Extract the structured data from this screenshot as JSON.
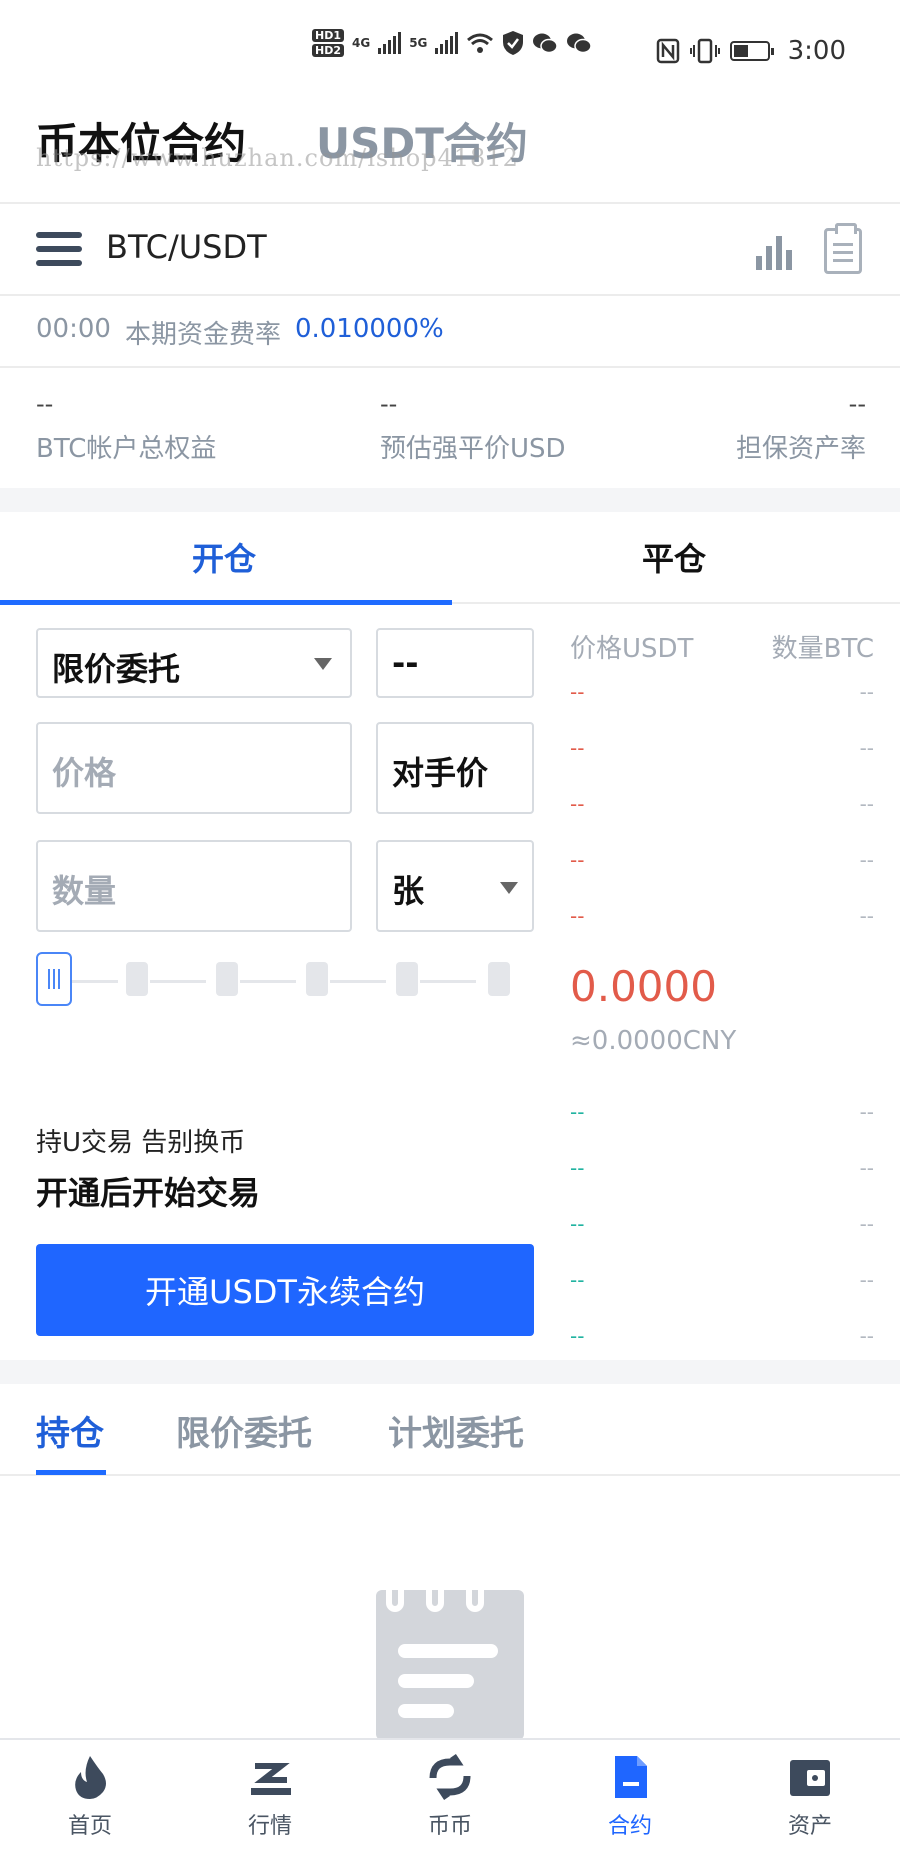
{
  "status_bar": {
    "hd1": "HD1",
    "hd2": "HD2",
    "net1": "4G",
    "net2": "5G",
    "time": "3:00"
  },
  "header": {
    "tab_coin": "币本位合约",
    "tab_usdt": "USDT合约",
    "watermark": "https://www.huzhan.com/ishop41812"
  },
  "symbol": "BTC/USDT",
  "funding": {
    "countdown": "00:00",
    "label": "本期资金费率",
    "rate": "0.010000%"
  },
  "stats": [
    {
      "value": "--",
      "label": "BTC帐户总权益"
    },
    {
      "value": "--",
      "label": "预估强平价USD"
    },
    {
      "value": "--",
      "label": "担保资产率"
    }
  ],
  "trade_tabs": {
    "open": "开仓",
    "close": "平仓"
  },
  "form": {
    "order_type": "限价委托",
    "leverage": "--",
    "price_placeholder": "价格",
    "counter_price": "对手价",
    "qty_placeholder": "数量",
    "unit": "张"
  },
  "promo": {
    "line1": "持U交易 告别换币",
    "line2": "开通后开始交易",
    "button": "开通USDT永续合约"
  },
  "orderbook": {
    "price_header": "价格USDT",
    "qty_header": "数量BTC",
    "asks": [
      {
        "p": "--",
        "q": "--"
      },
      {
        "p": "--",
        "q": "--"
      },
      {
        "p": "--",
        "q": "--"
      },
      {
        "p": "--",
        "q": "--"
      },
      {
        "p": "--",
        "q": "--"
      }
    ],
    "last_price": "0.0000",
    "last_cny": "≈0.0000CNY",
    "bids": [
      {
        "p": "--",
        "q": "--"
      },
      {
        "p": "--",
        "q": "--"
      },
      {
        "p": "--",
        "q": "--"
      },
      {
        "p": "--",
        "q": "--"
      },
      {
        "p": "--",
        "q": "--"
      }
    ]
  },
  "position_tabs": [
    "持仓",
    "限价委托",
    "计划委托"
  ],
  "nav": [
    {
      "label": "首页",
      "icon": "flame-icon"
    },
    {
      "label": "行情",
      "icon": "market-icon"
    },
    {
      "label": "币币",
      "icon": "exchange-icon"
    },
    {
      "label": "合约",
      "icon": "contract-icon"
    },
    {
      "label": "资产",
      "icon": "wallet-icon"
    }
  ],
  "colors": {
    "accent": "#1f66ff",
    "ask": "#e25b4a",
    "bid": "#21b3a0",
    "muted": "#8b96a3"
  }
}
